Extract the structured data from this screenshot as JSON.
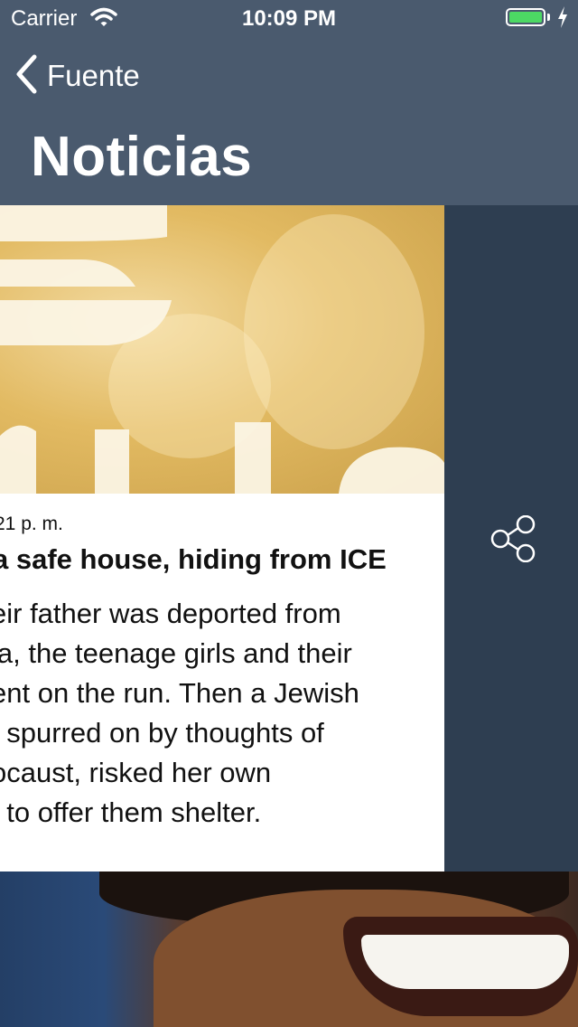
{
  "status_bar": {
    "carrier": "Carrier",
    "time": "10:09 PM",
    "battery_level": 1.0
  },
  "nav": {
    "back_label": "Fuente",
    "title": "Noticias"
  },
  "article": {
    "date": "21 p. m.",
    "headline": "a safe house, hiding from ICE",
    "body_lines": [
      "eir father was deported from",
      "ia, the teenage girls and their",
      "ent on the run. Then a Jewish",
      ". spurred on by thoughts of",
      "ocaust, risked her own",
      "t to offer them shelter."
    ]
  },
  "icons": {
    "back": "chevron-left-icon",
    "share": "share-icon",
    "wifi": "wifi-icon",
    "battery": "battery-icon",
    "charging": "bolt-icon"
  },
  "colors": {
    "header": "#4a5a6e",
    "side_panel": "#2e3e51",
    "battery_fill": "#4cd964"
  }
}
